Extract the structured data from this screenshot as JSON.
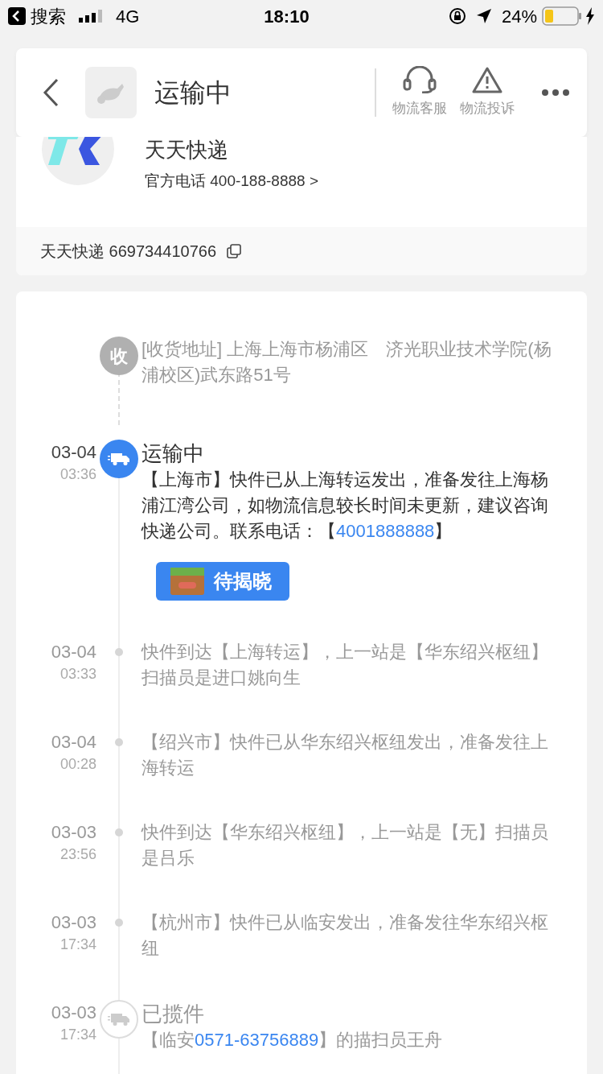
{
  "status_bar": {
    "back_label": "搜索",
    "network": "4G",
    "time": "18:10",
    "battery": "24%"
  },
  "header": {
    "title": "运输中",
    "actions": [
      {
        "kind": "service",
        "label": "物流客服"
      },
      {
        "kind": "complaint",
        "label": "物流投诉"
      }
    ]
  },
  "carrier": {
    "name": "天天快递",
    "phone": "官方电话 400-188-8888 >",
    "tracking": "天天快递 669734410766"
  },
  "timeline": [
    {
      "kind": "address",
      "icon_text": "收",
      "parts": [
        {
          "text": "[收货地址] 上海上海市杨浦区　济光职业技术学院(杨浦校区)武东路51号",
          "kind": "text"
        }
      ]
    },
    {
      "kind": "status",
      "active": true,
      "date": "03-04",
      "time": "03:36",
      "title": "运输中",
      "parts": [
        {
          "text": "【上海市】快件已从上海转运发出，准备发往上海杨浦江湾公司，如物流信息较长时间未更新，建议咨询快递公司。联系电话：【",
          "kind": "text"
        },
        {
          "text": "4001888888",
          "kind": "phone"
        },
        {
          "text": "】",
          "kind": "text"
        }
      ],
      "badge": "待揭晓"
    },
    {
      "kind": "event",
      "date": "03-04",
      "time": "03:33",
      "parts": [
        {
          "text": "快件到达【上海转运】，上一站是【华东绍兴枢纽】扫描员是进口姚向生",
          "kind": "text"
        }
      ]
    },
    {
      "kind": "event",
      "date": "03-04",
      "time": "00:28",
      "parts": [
        {
          "text": "【绍兴市】快件已从华东绍兴枢纽发出，准备发往上海转运",
          "kind": "text"
        }
      ]
    },
    {
      "kind": "event",
      "date": "03-03",
      "time": "23:56",
      "parts": [
        {
          "text": "快件到达【华东绍兴枢纽】，上一站是【无】扫描员是吕乐",
          "kind": "text"
        }
      ]
    },
    {
      "kind": "event",
      "date": "03-03",
      "time": "17:34",
      "parts": [
        {
          "text": "【杭州市】快件已从临安发出，准备发往华东绍兴枢纽",
          "kind": "text"
        }
      ]
    },
    {
      "kind": "status",
      "active": false,
      "date": "03-03",
      "time": "17:34",
      "title": "已揽件",
      "parts": [
        {
          "text": "【临安",
          "kind": "text"
        },
        {
          "text": "0571-63756889",
          "kind": "phone"
        },
        {
          "text": "】的描扫员王舟",
          "kind": "text"
        }
      ]
    }
  ]
}
